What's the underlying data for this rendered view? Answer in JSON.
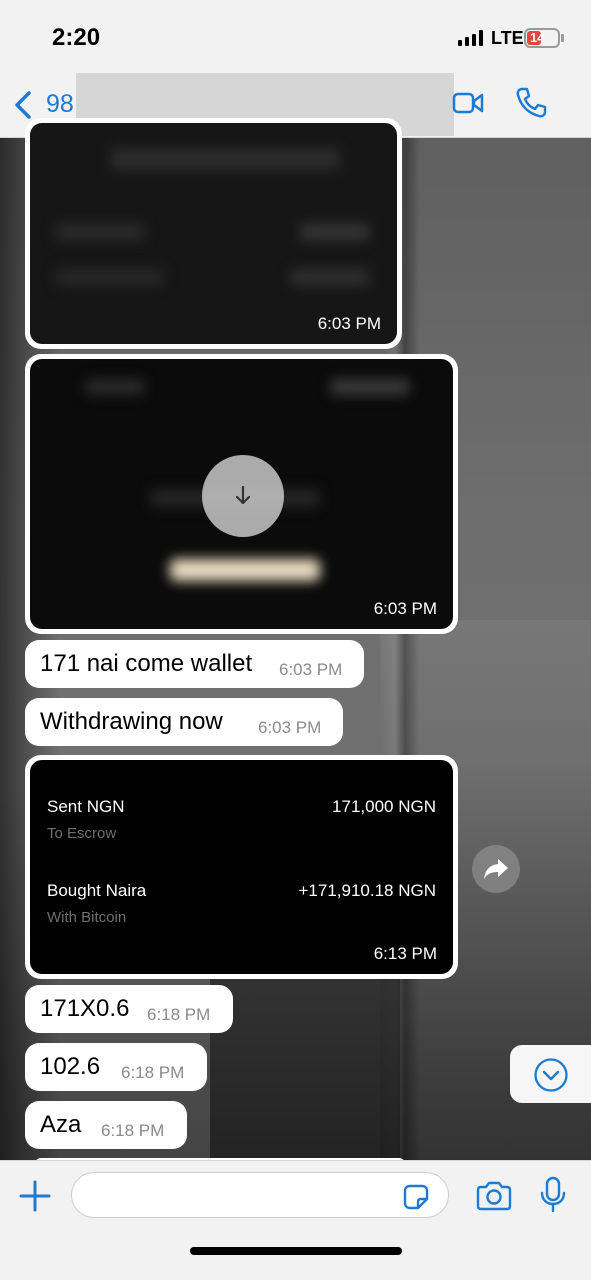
{
  "status_bar": {
    "time": "2:20",
    "network": "LTE",
    "battery": "14"
  },
  "header": {
    "back_count": "98",
    "icons": [
      "chevron-left-icon",
      "video-call-icon",
      "phone-icon"
    ]
  },
  "messages": [
    {
      "type": "image",
      "time": "6:03 PM"
    },
    {
      "type": "image",
      "time": "6:03 PM",
      "action": "download-icon"
    },
    {
      "type": "text",
      "text": "171 nai come wallet",
      "time": "6:03 PM"
    },
    {
      "type": "text",
      "text": "Withdrawing now",
      "time": "6:03 PM"
    },
    {
      "type": "receipt",
      "time": "6:13 PM",
      "rows": [
        {
          "label": "Sent NGN",
          "sub": "To Escrow",
          "amount": "171,000 NGN"
        },
        {
          "label": "Bought Naira",
          "sub": "With Bitcoin",
          "amount": "+171,910.18 NGN"
        }
      ]
    },
    {
      "type": "text",
      "text": "171X0.6",
      "time": "6:18 PM"
    },
    {
      "type": "text",
      "text": "102.6",
      "time": "6:18 PM"
    },
    {
      "type": "text",
      "text": "Aza",
      "time": "6:18 PM"
    }
  ],
  "composer": {
    "placeholder": "",
    "icons": [
      "plus-icon",
      "sticker-icon",
      "camera-icon",
      "microphone-icon"
    ]
  },
  "colors": {
    "accent": "#1d7bd3",
    "battery_low": "#e24a3f",
    "bubble": "#ffffff",
    "timestamp": "#8a8a8a"
  }
}
